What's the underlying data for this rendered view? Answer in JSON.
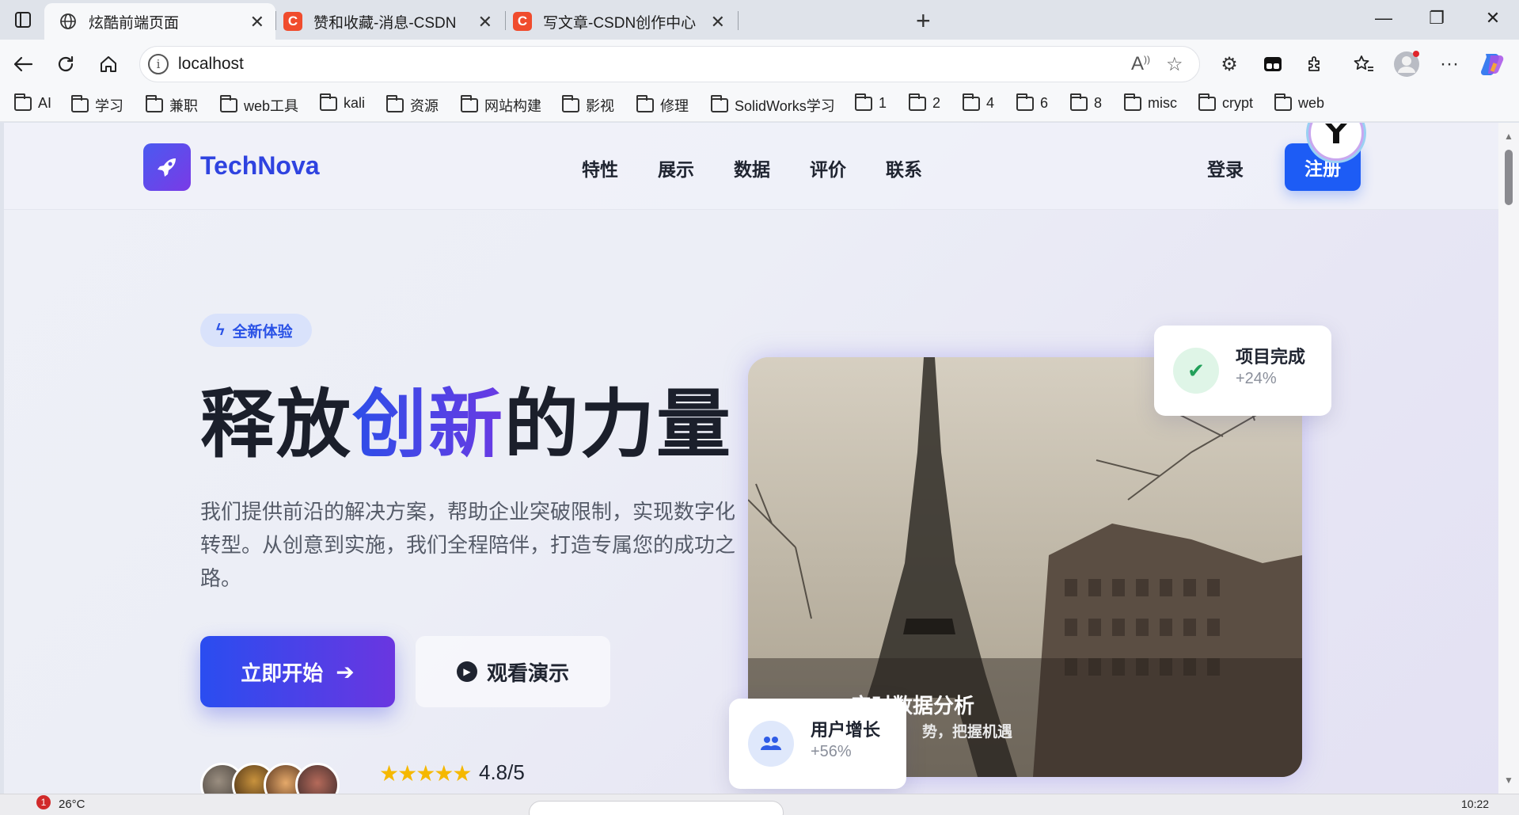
{
  "browser": {
    "tabs": [
      {
        "title": "炫酷前端页面",
        "favicon": "globe-icon",
        "active": true
      },
      {
        "title": "赞和收藏-消息-CSDN",
        "favicon": "csdn-icon",
        "favicon_letter": "C"
      },
      {
        "title": "写文章-CSDN创作中心",
        "favicon": "csdn-icon",
        "favicon_letter": "C"
      }
    ],
    "address": "localhost",
    "bookmarks": [
      "AI",
      "学习",
      "兼职",
      "web工具",
      "kali",
      "资源",
      "网站构建",
      "影视",
      "修理",
      "SolidWorks学习",
      "1",
      "2",
      "4",
      "6",
      "8",
      "misc",
      "crypt",
      "web"
    ]
  },
  "page": {
    "brand": "TechNova",
    "nav": [
      "特性",
      "展示",
      "数据",
      "评价",
      "联系"
    ],
    "login": "登录",
    "signup": "注册",
    "badge": "全新体验",
    "title_pre": "释放",
    "title_highlight": "创新",
    "title_post": "的力量",
    "description": "我们提供前沿的解决方案，帮助企业突破限制，实现数字化转型。从创意到实施，我们全程陪伴，打造专属您的成功之路。",
    "primary_button": "立即开始",
    "secondary_button": "观看演示",
    "stars": "★★★★★",
    "rating": "4.8/5",
    "image_caption": "实时数据分析",
    "image_subcaption": "势，把握机遇",
    "card_project": {
      "title": "项目完成",
      "value": "+24%"
    },
    "card_users": {
      "title": "用户增长",
      "value": "+56%"
    }
  },
  "taskbar": {
    "weather": "26°C",
    "notification_count": "1",
    "time": "10:22"
  },
  "colors": {
    "accent": "#2f43e0",
    "signup_bg": "#1d5cf5",
    "star": "#f5b800",
    "success": "#22a05a"
  }
}
